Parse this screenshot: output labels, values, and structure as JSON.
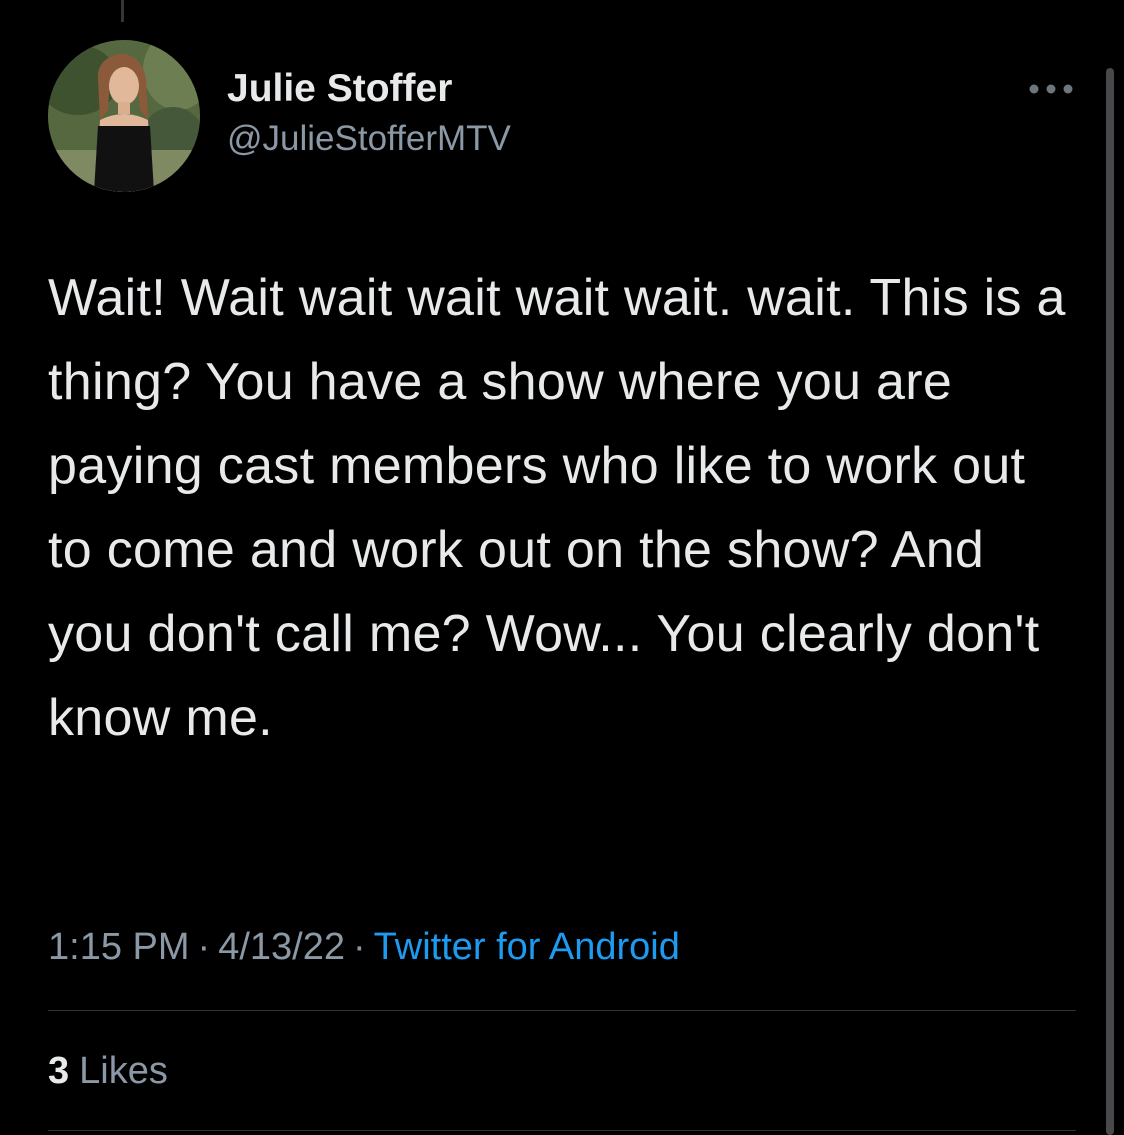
{
  "tweet": {
    "author": {
      "display_name": "Julie Stoffer",
      "handle": "@JulieStofferMTV"
    },
    "text": "Wait! Wait wait wait wait wait. wait. This is a thing? You have a show where you are paying cast members who like to work out to come and work out on the show? And you don't call me? Wow... You clearly don't know me.",
    "time": "1:15 PM",
    "date": "4/13/22",
    "separator": "·",
    "source": "Twitter for Android",
    "likes_count": "3",
    "likes_label": "Likes"
  },
  "icons": {
    "more": "more-horizontal-icon",
    "avatar": "profile-photo"
  },
  "colors": {
    "background": "#000000",
    "primary_text": "#e7e9ea",
    "secondary_text": "#8b98a5",
    "link": "#1d9bf0",
    "divider": "#2f3336"
  }
}
